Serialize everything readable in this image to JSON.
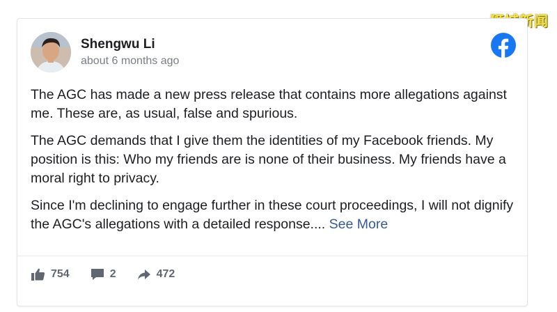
{
  "watermark": "狮城新闻",
  "post": {
    "author": "Shengwu Li",
    "timestamp": "about 6 months ago",
    "paragraphs": [
      "The AGC has made a new press release that contains more allegations against me. These are, as usual, false and spurious.",
      "The AGC demands that I give them the identities of my Facebook friends. My position is this: Who my friends are is none of their business. My friends have a moral right to privacy.",
      "Since I'm declining to engage further in these court proceedings, I will not dignify the AGC's allegations with a detailed response...."
    ],
    "see_more": "See More",
    "stats": {
      "likes": "754",
      "comments": "2",
      "shares": "472"
    }
  },
  "icons": {
    "brand": "facebook-icon",
    "like": "thumbs-up-icon",
    "comment": "comment-bubble-icon",
    "share": "share-arrow-icon"
  },
  "colors": {
    "facebook_blue": "#1877f2",
    "link": "#385898",
    "text": "#1c1e21",
    "muted": "#7a7e84",
    "watermark": "#f3e24a"
  }
}
